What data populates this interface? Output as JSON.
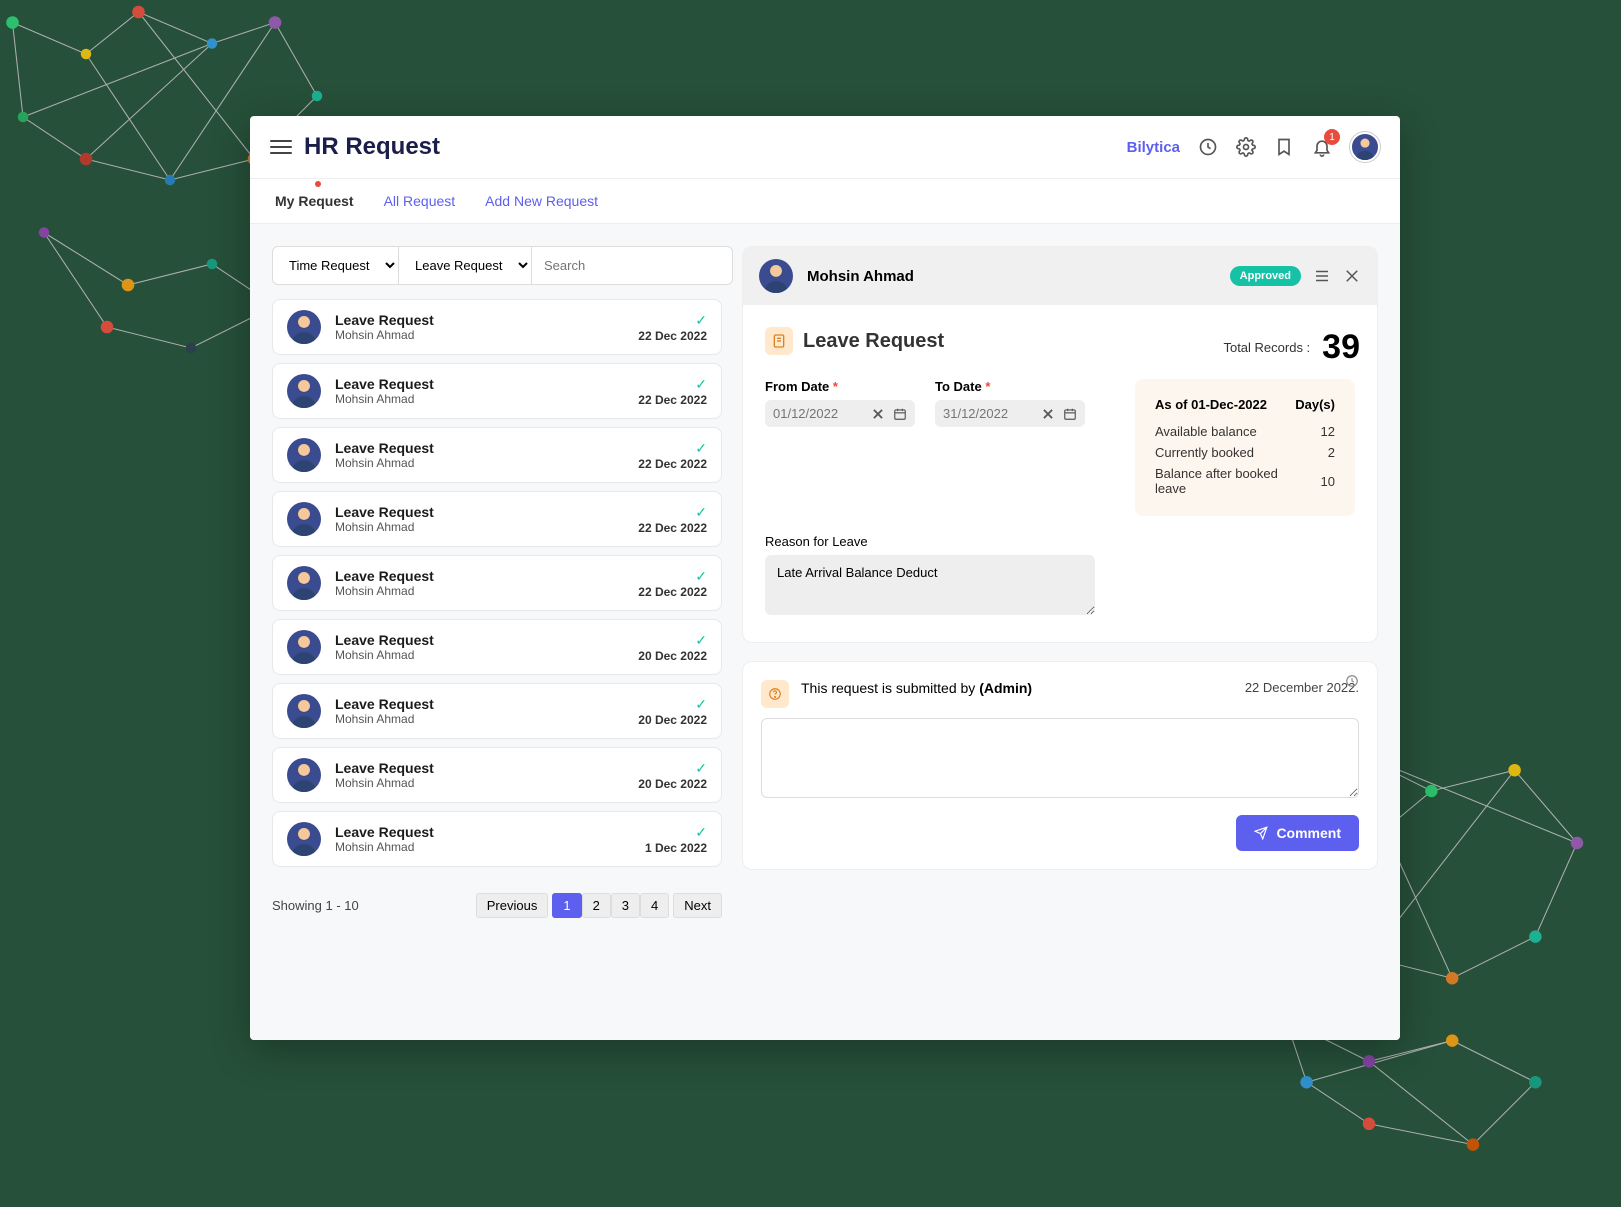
{
  "header": {
    "title": "HR Request",
    "brand": "Bilytica",
    "notification_count": "1"
  },
  "tabs": [
    {
      "label": "My Request",
      "active": true
    },
    {
      "label": "All Request",
      "active": false
    },
    {
      "label": "Add New Request",
      "active": false
    }
  ],
  "filters": {
    "type_select": "Time Request",
    "subtype_select": "Leave Request",
    "search_placeholder": "Search"
  },
  "totals": {
    "label": "Total Records :",
    "value": "39"
  },
  "list": [
    {
      "title": "Leave Request",
      "name": "Mohsin Ahmad",
      "date": "22 Dec 2022"
    },
    {
      "title": "Leave Request",
      "name": "Mohsin Ahmad",
      "date": "22 Dec 2022"
    },
    {
      "title": "Leave Request",
      "name": "Mohsin Ahmad",
      "date": "22 Dec 2022"
    },
    {
      "title": "Leave Request",
      "name": "Mohsin Ahmad",
      "date": "22 Dec 2022"
    },
    {
      "title": "Leave Request",
      "name": "Mohsin Ahmad",
      "date": "22 Dec 2022"
    },
    {
      "title": "Leave Request",
      "name": "Mohsin Ahmad",
      "date": "20 Dec 2022"
    },
    {
      "title": "Leave Request",
      "name": "Mohsin Ahmad",
      "date": "20 Dec 2022"
    },
    {
      "title": "Leave Request",
      "name": "Mohsin Ahmad",
      "date": "20 Dec 2022"
    },
    {
      "title": "Leave Request",
      "name": "Mohsin Ahmad",
      "date": "1 Dec 2022"
    }
  ],
  "pager": {
    "showing": "Showing 1 - 10",
    "prev": "Previous",
    "pages": [
      "1",
      "2",
      "3",
      "4"
    ],
    "next": "Next",
    "current": "1"
  },
  "detail": {
    "name": "Mohsin Ahmad",
    "status": "Approved",
    "section_title": "Leave Request",
    "from_label": "From Date",
    "to_label": "To Date",
    "from_value": "01/12/2022",
    "to_value": "31/12/2022",
    "reason_label": "Reason for Leave",
    "reason_value": "Late Arrival Balance Deduct",
    "balance": {
      "asof": "As of 01-Dec-2022",
      "days_hdr": "Day(s)",
      "rows": [
        {
          "l": "Available balance",
          "v": "12"
        },
        {
          "l": "Currently booked",
          "v": "2"
        },
        {
          "l": "Balance after booked leave",
          "v": "10"
        }
      ]
    }
  },
  "comment": {
    "submitted_prefix": "This request is submitted by ",
    "submitted_by": "(Admin)",
    "submitted_date": "22 December 2022.",
    "button": "Comment"
  }
}
